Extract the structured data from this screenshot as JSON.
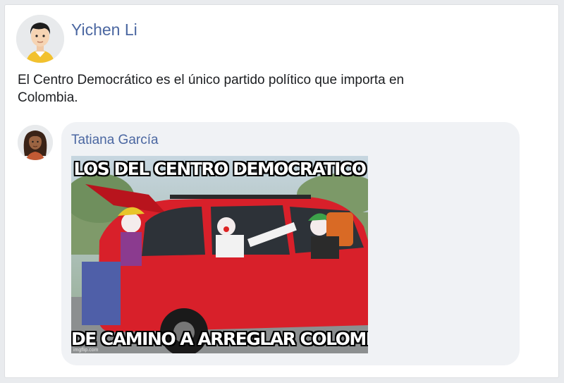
{
  "post": {
    "author": "Yichen Li",
    "text": "El Centro Democrático es el único partido político que importa en Colombia."
  },
  "comment": {
    "author": "Tatiana García",
    "meme": {
      "top_text": "LOS DEL CENTRO DEMOCRATICO",
      "bottom_text": "DE CAMINO A ARREGLAR COLOMBIA",
      "watermark": "imgflip.com"
    }
  },
  "colors": {
    "name_link": "#4b67a1",
    "bubble_bg": "#f0f2f5",
    "car_red": "#d8202a"
  },
  "icons": {
    "author_avatar": "avatar-man-icon",
    "commenter_avatar": "avatar-woman-icon"
  }
}
